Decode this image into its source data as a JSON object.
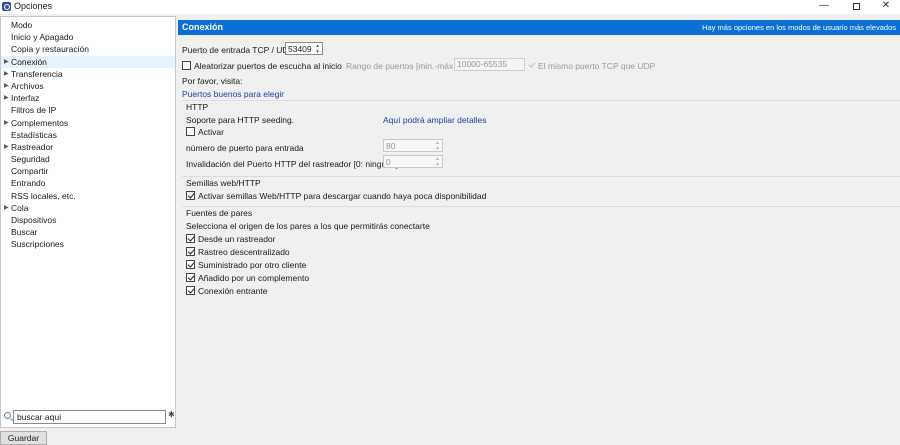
{
  "window": {
    "title": "Opciones",
    "minimize": "—",
    "maximize": "",
    "close": "✕"
  },
  "sidebar": {
    "items": [
      {
        "label": "Modo",
        "arrow": ""
      },
      {
        "label": "Inicio y Apagado",
        "arrow": ""
      },
      {
        "label": "Copia y restauración",
        "arrow": ""
      },
      {
        "label": "Conexión",
        "arrow": "▶",
        "selected": true
      },
      {
        "label": "Transferencia",
        "arrow": "▶"
      },
      {
        "label": "Archivos",
        "arrow": "▶"
      },
      {
        "label": "Interfaz",
        "arrow": "▶"
      },
      {
        "label": "Filtros de IP",
        "arrow": ""
      },
      {
        "label": "Complementos",
        "arrow": "▶"
      },
      {
        "label": "Estadísticas",
        "arrow": ""
      },
      {
        "label": "Rastreador",
        "arrow": "▶"
      },
      {
        "label": "Seguridad",
        "arrow": ""
      },
      {
        "label": "Compartir",
        "arrow": ""
      },
      {
        "label": "Entrando",
        "arrow": ""
      },
      {
        "label": "RSS locales, etc.",
        "arrow": ""
      },
      {
        "label": "Cola",
        "arrow": "▶"
      },
      {
        "label": "Dispositivos",
        "arrow": ""
      },
      {
        "label": "Buscar",
        "arrow": ""
      },
      {
        "label": "Suscripciones",
        "arrow": ""
      }
    ],
    "search": {
      "value": "buscar aquí",
      "clear": "✱"
    }
  },
  "footer": {
    "save_label": "Guardar"
  },
  "main": {
    "title": "Conexión",
    "hint": "Hay más opciones en los modos de usuario más elevados",
    "port": {
      "label": "Puerto de entrada TCP / UDP",
      "value": "53409"
    },
    "randomize": {
      "label": "Aleatorizar puertos de escucha al inicio",
      "checked": false,
      "range_label": "Rango de puertos [min.-máx.]:",
      "range_value": "10000-65535",
      "same_port_label": "El mismo puerto TCP que UDP"
    },
    "visit_label": "Por favor, visita:",
    "good_ports_link": "Puertos buenos para elegir",
    "http": {
      "section": "HTTP",
      "support_label": "Soporte para HTTP seeding.",
      "details_link": "Aquí podrá ampliar detalles",
      "activate_label": "Activar",
      "activate_checked": false,
      "port_label": "número de puerto para entrada",
      "port_value": "80",
      "tracker_label": "Invalidación del Puerto HTTP del rastreador [0: ninguno]",
      "tracker_value": "0"
    },
    "web_seeds": {
      "section": "Semillas web/HTTP",
      "label": "Activar semillas Web/HTTP para descargar cuando haya poca disponibilidad",
      "checked": true
    },
    "peer_sources": {
      "section": "Fuentes de pares",
      "description": "Selecciona el origen de los pares a los que permitirás conectarte",
      "items": [
        {
          "label": "Desde un rastreador",
          "checked": true
        },
        {
          "label": "Rastreo descentralizado",
          "checked": true
        },
        {
          "label": "Suministrado por otro cliente",
          "checked": true
        },
        {
          "label": "Añadido por un complemento",
          "checked": true
        },
        {
          "label": "Conexión entrante",
          "checked": true
        }
      ]
    }
  },
  "colors": {
    "header": "#0a6fd6",
    "link": "#1a3fa6",
    "selected": "#e5f1fb"
  }
}
